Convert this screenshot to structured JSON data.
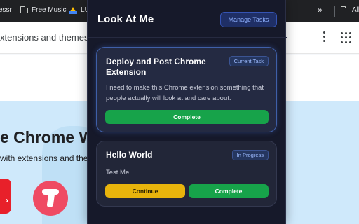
{
  "browser": {
    "bookmarks": [
      {
        "label": "essr",
        "icon": "none"
      },
      {
        "label": "Free Music",
        "icon": "folder-icon"
      },
      {
        "label": "LU",
        "icon": "drive-icon"
      },
      {
        "label": "»",
        "icon": "none"
      },
      {
        "label": "All",
        "icon": "folder-icon"
      }
    ],
    "search_text": "xtensions and themes",
    "hero_title": "e Chrome W",
    "hero_subtitle": "with extensions and ther"
  },
  "popup": {
    "title": "Look At Me",
    "manage_button": "Manage Tasks",
    "tasks": [
      {
        "title": "Deploy and Post Chrome Extension",
        "badge": "Current Task",
        "description": "I need to make this Chrome extension something that people actually will look at and care about.",
        "buttons": [
          "Complete"
        ]
      },
      {
        "title": "Hello World",
        "badge": "In Progress",
        "description": "Test Me",
        "buttons": [
          "Continue",
          "Complete"
        ]
      }
    ]
  },
  "colors": {
    "popup_bg": "#16192a",
    "accent_blue": "#3553b3",
    "complete_green": "#17a34a",
    "continue_yellow": "#e8b40c"
  }
}
